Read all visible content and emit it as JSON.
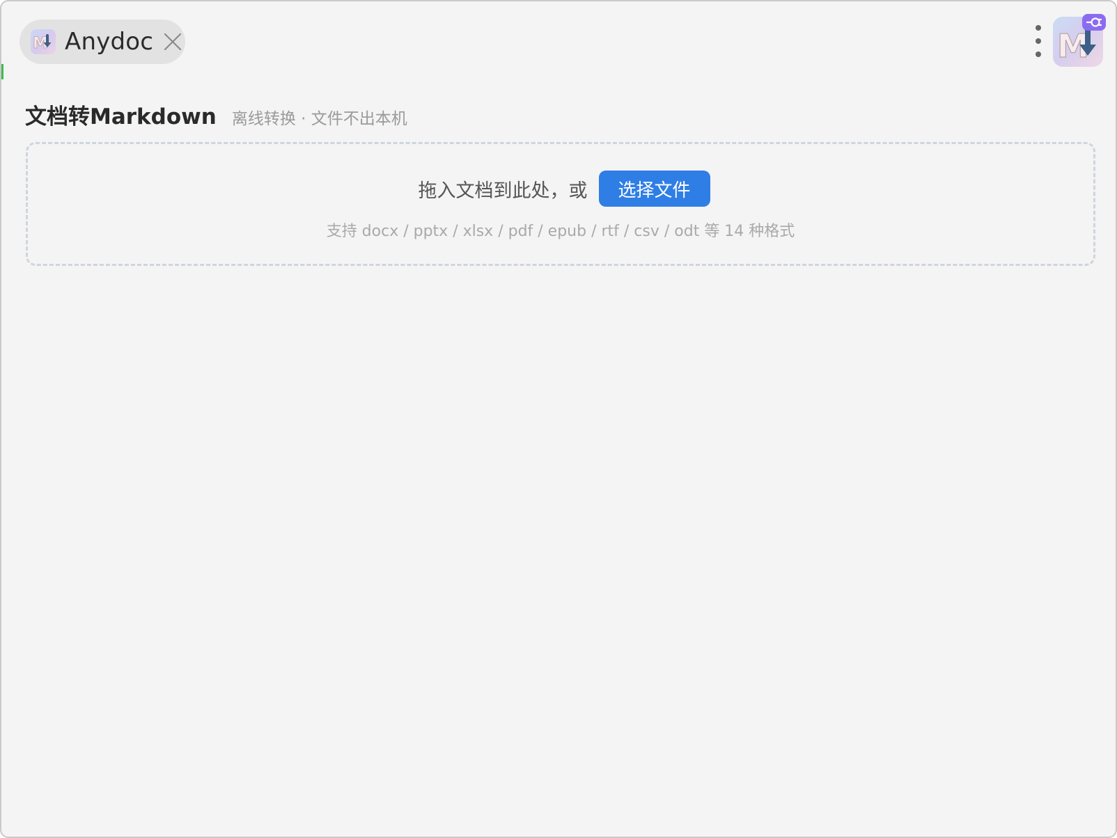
{
  "tab": {
    "title": "Anydoc",
    "icon": "markdown-download-icon",
    "close_icon": "close-icon"
  },
  "toolbar": {
    "more_icon": "more-vertical-icon",
    "logo_icon": "markdown-download-logo",
    "badge_icon": "plugin-icon"
  },
  "header": {
    "title": "文档转Markdown",
    "subtitle": "离线转换 · 文件不出本机"
  },
  "dropzone": {
    "prompt": "拖入文档到此处，或",
    "button_label": "选择文件",
    "formats_hint": "支持 docx / pptx / xlsx / pdf / epub / rtf / csv / odt 等 14 种格式"
  },
  "colors": {
    "background": "#f4f4f4",
    "tab_pill": "#e2e2e2",
    "primary_button": "#2f7ee6",
    "badge": "#8b6cf0",
    "dropzone_border": "#cfd5dc"
  }
}
